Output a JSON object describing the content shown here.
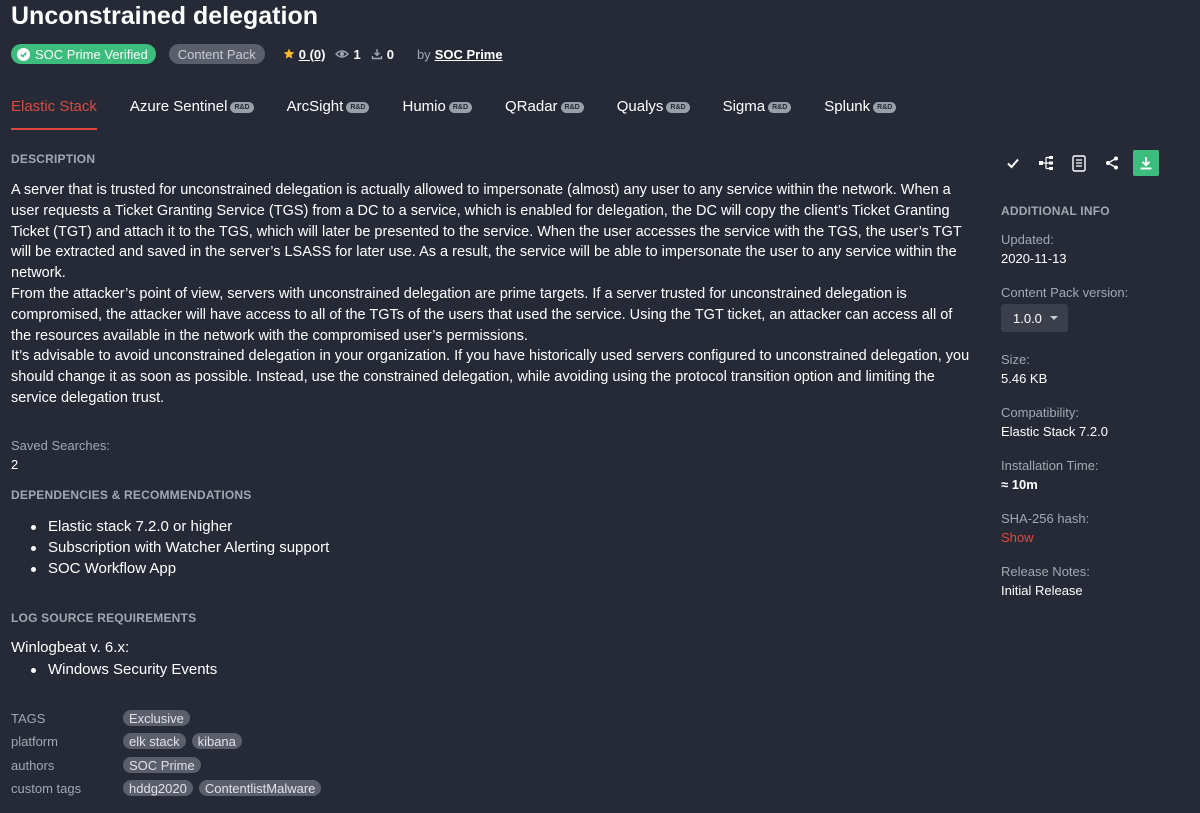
{
  "header": {
    "title": "Unconstrained delegation",
    "verified_label": "SOC Prime Verified",
    "type_label": "Content Pack",
    "rating": "0 (0)",
    "views": "1",
    "downloads": "0",
    "by_label": "by",
    "author": "SOC Prime"
  },
  "tabs": [
    {
      "label": "Elastic Stack",
      "rd": "",
      "active": true
    },
    {
      "label": "Azure Sentinel",
      "rd": "R&D"
    },
    {
      "label": "ArcSight",
      "rd": "R&D"
    },
    {
      "label": "Humio",
      "rd": "R&D"
    },
    {
      "label": "QRadar",
      "rd": "R&D"
    },
    {
      "label": "Qualys",
      "rd": "R&D"
    },
    {
      "label": "Sigma",
      "rd": "R&D"
    },
    {
      "label": "Splunk",
      "rd": "R&D"
    }
  ],
  "description": {
    "heading": "DESCRIPTION",
    "paragraphs": [
      "A server that is trusted for unconstrained delegation is actually allowed to impersonate (almost) any user to any service within the network. When a user requests a Ticket Granting Service (TGS) from a DC to a service, which is enabled for delegation, the DC will copy the client’s Ticket Granting Ticket (TGT) and attach it to the TGS, which will later be presented to the service. When the user accesses the service with the TGS, the user’s TGT will be extracted and saved in the server’s LSASS for later use. As a result, the service will be able to impersonate the user to any service within the network.",
      "From the attacker’s point of view, servers with unconstrained delegation are prime targets. If a server trusted for unconstrained delegation is compromised, the attacker will have access to all of the TGTs of the users that used the service. Using the TGT ticket, an attacker can access all of the resources available in the network with the compromised user’s permissions.",
      "It’s advisable to avoid unconstrained delegation in your organization. If you have historically used servers configured to unconstrained delegation, you should change it as soon as possible. Instead, use the constrained delegation, while avoiding using the protocol transition option and limiting the service delegation trust."
    ]
  },
  "saved_searches": {
    "label": "Saved Searches:",
    "value": "2"
  },
  "dependencies": {
    "heading": "DEPENDENCIES & RECOMMENDATIONS",
    "items": [
      "Elastic stack 7.2.0 or higher",
      "Subscription with Watcher Alerting support",
      "SOC Workflow App"
    ]
  },
  "log_sources": {
    "heading": "LOG SOURCE REQUIREMENTS",
    "source": "Winlogbeat v. 6.x:",
    "items": [
      "Windows Security Events"
    ]
  },
  "tags": {
    "rows": [
      {
        "label": "TAGS",
        "tags": [
          "Exclusive"
        ]
      },
      {
        "label": "platform",
        "tags": [
          "elk stack",
          "kibana"
        ]
      },
      {
        "label": "authors",
        "tags": [
          "SOC Prime"
        ]
      },
      {
        "label": "custom tags",
        "tags": [
          "hddg2020",
          "ContentlistMalware"
        ]
      }
    ]
  },
  "actions": {
    "icons": [
      "check-icon",
      "tree-icon",
      "document-icon",
      "share-icon",
      "download-icon"
    ]
  },
  "additional_info": {
    "heading": "ADDITIONAL INFO",
    "updated_label": "Updated:",
    "updated": "2020-11-13",
    "version_label": "Content Pack version:",
    "version": "1.0.0",
    "size_label": "Size:",
    "size": "5.46 KB",
    "compat_label": "Compatibility:",
    "compat": "Elastic Stack 7.2.0",
    "install_label": "Installation Time:",
    "install": "≈ 10m",
    "hash_label": "SHA-256 hash:",
    "hash_action": "Show",
    "notes_label": "Release Notes:",
    "notes": "Initial Release"
  },
  "colors": {
    "accent": "#e0473f",
    "verified": "#3dbd7d",
    "background": "#262a36"
  }
}
